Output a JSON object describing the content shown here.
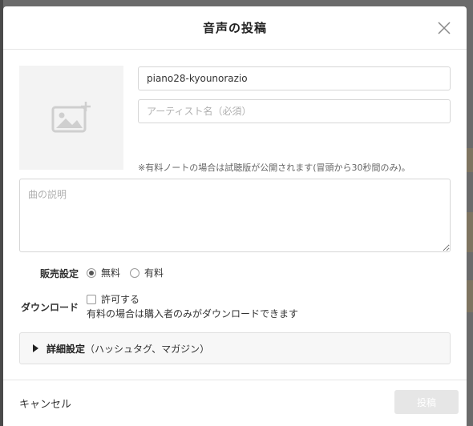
{
  "modal": {
    "title": "音声の投稿"
  },
  "form": {
    "title_value": "piano28-kyounorazio",
    "artist_placeholder": "アーティスト名（必須）",
    "trial_note": "※有料ノートの場合は試聴版が公開されます(冒頭から30秒間のみ)。",
    "description_placeholder": "曲の説明"
  },
  "sales": {
    "label": "販売設定",
    "options": [
      {
        "label": "無料",
        "selected": true
      },
      {
        "label": "有料",
        "selected": false
      }
    ]
  },
  "download": {
    "label": "ダウンロード",
    "checkbox_label": "許可する",
    "checked": false,
    "note": "有料の場合は購入者のみがダウンロードできます"
  },
  "details": {
    "label_bold": "詳細設定",
    "label_rest": "（ハッシュタグ、マガジン）"
  },
  "footer": {
    "cancel_label": "キャンセル",
    "submit_label": "投稿"
  },
  "icons": {
    "close": "close-icon",
    "image_add": "image-add-icon",
    "expand": "triangle-right-icon"
  }
}
